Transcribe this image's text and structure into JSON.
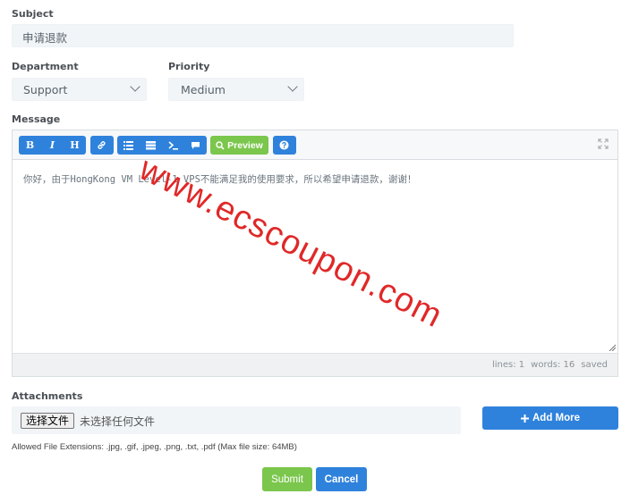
{
  "subject": {
    "label": "Subject",
    "value": "申请退款"
  },
  "department": {
    "label": "Department",
    "value": "Support"
  },
  "priority": {
    "label": "Priority",
    "value": "Medium"
  },
  "message": {
    "label": "Message",
    "toolbar": {
      "bold": "B",
      "italic": "I",
      "heading": "H",
      "preview": "Preview"
    },
    "text": "你好，由于HongKong VM Level-1 VPS不能满足我的使用要求，所以希望申请退款，谢谢！",
    "status": {
      "lines": "lines: 1",
      "words": "words: 16",
      "saved": "saved"
    }
  },
  "attachments": {
    "label": "Attachments",
    "choose_button": "选择文件",
    "file_status": "未选择任何文件",
    "add_more": "Add More",
    "allowed": "Allowed File Extensions: .jpg, .gif, .jpeg, .png, .txt, .pdf (Max file size: 64MB)"
  },
  "actions": {
    "submit": "Submit",
    "cancel": "Cancel"
  },
  "watermark": "www.ecscoupon.com",
  "colors": {
    "primary": "#2f82dc",
    "success": "#7bc64c",
    "watermark": "#e02828"
  }
}
